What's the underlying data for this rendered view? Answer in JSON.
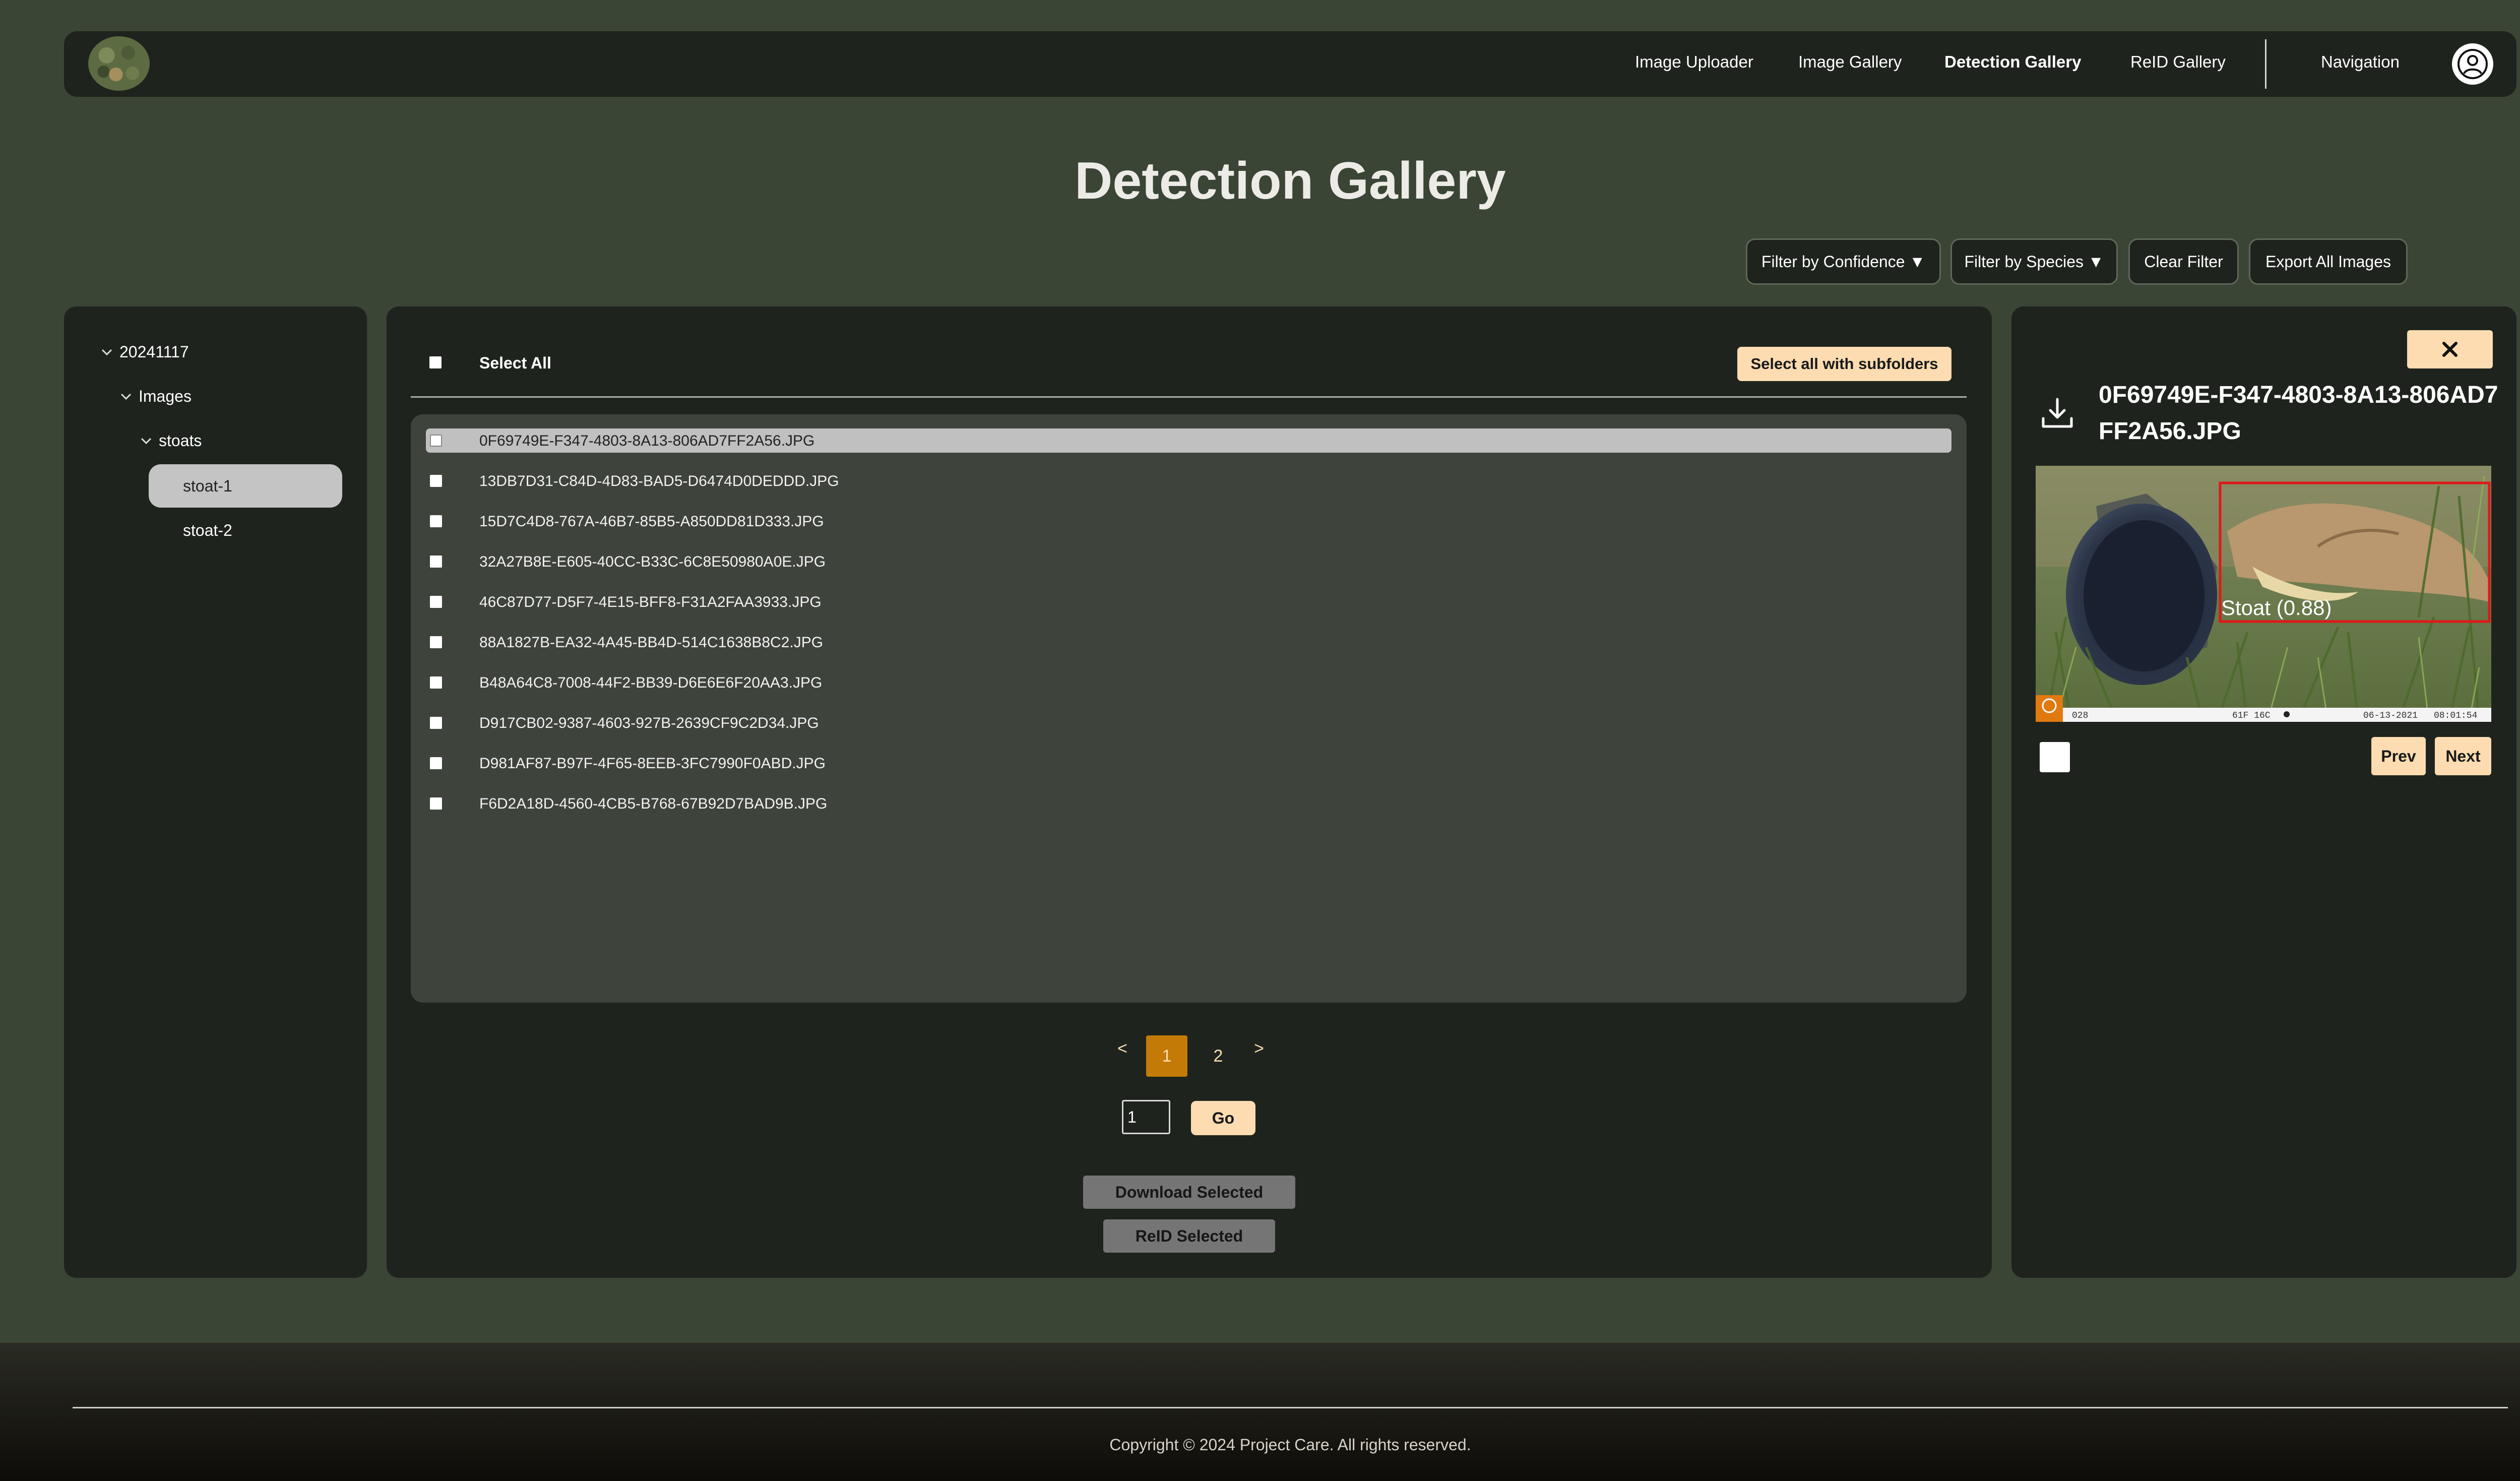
{
  "nav": {
    "links": [
      "Image Uploader",
      "Image Gallery",
      "Detection Gallery",
      "ReID Gallery"
    ],
    "active": "Detection Gallery",
    "navigation_label": "Navigation"
  },
  "page": {
    "title": "Detection Gallery"
  },
  "filters": {
    "confidence": "Filter by Confidence ▼",
    "species": "Filter by Species ▼",
    "clear": "Clear Filter",
    "export": "Export All Images"
  },
  "tree": {
    "root": "20241117",
    "images": "Images",
    "stoats": "stoats",
    "leaves": [
      "stoat-1",
      "stoat-2"
    ],
    "selected": "stoat-1"
  },
  "list": {
    "select_all": "Select All",
    "select_subfolders": "Select all with subfolders",
    "files": [
      "0F69749E-F347-4803-8A13-806AD7FF2A56.JPG",
      "13DB7D31-C84D-4D83-BAD5-D6474D0DEDDD.JPG",
      "15D7C4D8-767A-46B7-85B5-A850DD81D333.JPG",
      "32A27B8E-E605-40CC-B33C-6C8E50980A0E.JPG",
      "46C87D77-D5F7-4E15-BFF8-F31A2FAA3933.JPG",
      "88A1827B-EA32-4A45-BB4D-514C1638B8C2.JPG",
      "B48A64C8-7008-44F2-BB39-D6E6E6F20AA3.JPG",
      "D917CB02-9387-4603-927B-2639CF9C2D34.JPG",
      "D981AF87-B97F-4F65-8EEB-3FC7990F0ABD.JPG",
      "F6D2A18D-4560-4CB5-B768-67B92D7BAD9B.JPG"
    ],
    "highlighted_index": 0
  },
  "pager": {
    "prev": "<",
    "pages": [
      "1",
      "2"
    ],
    "current": "1",
    "next": ">",
    "goto_value": "1",
    "go": "Go"
  },
  "actions": {
    "download": "Download Selected",
    "reid": "ReID Selected"
  },
  "detail": {
    "filename": "0F69749E-F347-4803-8A13-806AD7FF2A56.JPG",
    "detection_label": "Stoat  (0.88)",
    "cam_temp": "61F 16C",
    "cam_date": "06-13-2021",
    "cam_time": "08:01:54",
    "cam_id": "028",
    "prev": "Prev",
    "next": "Next"
  },
  "footer": {
    "copyright": "Copyright © 2024 Project Care. All rights reserved."
  },
  "colors": {
    "page_bg": "#3a4535",
    "panel_bg": "#1e231d",
    "accent": "#fcdcb0",
    "current_page": "#c47a06",
    "detection_box": "#e01818"
  },
  "icons": [
    "logo-icon",
    "user-icon",
    "chevron-down-icon",
    "download-icon",
    "close-icon"
  ]
}
